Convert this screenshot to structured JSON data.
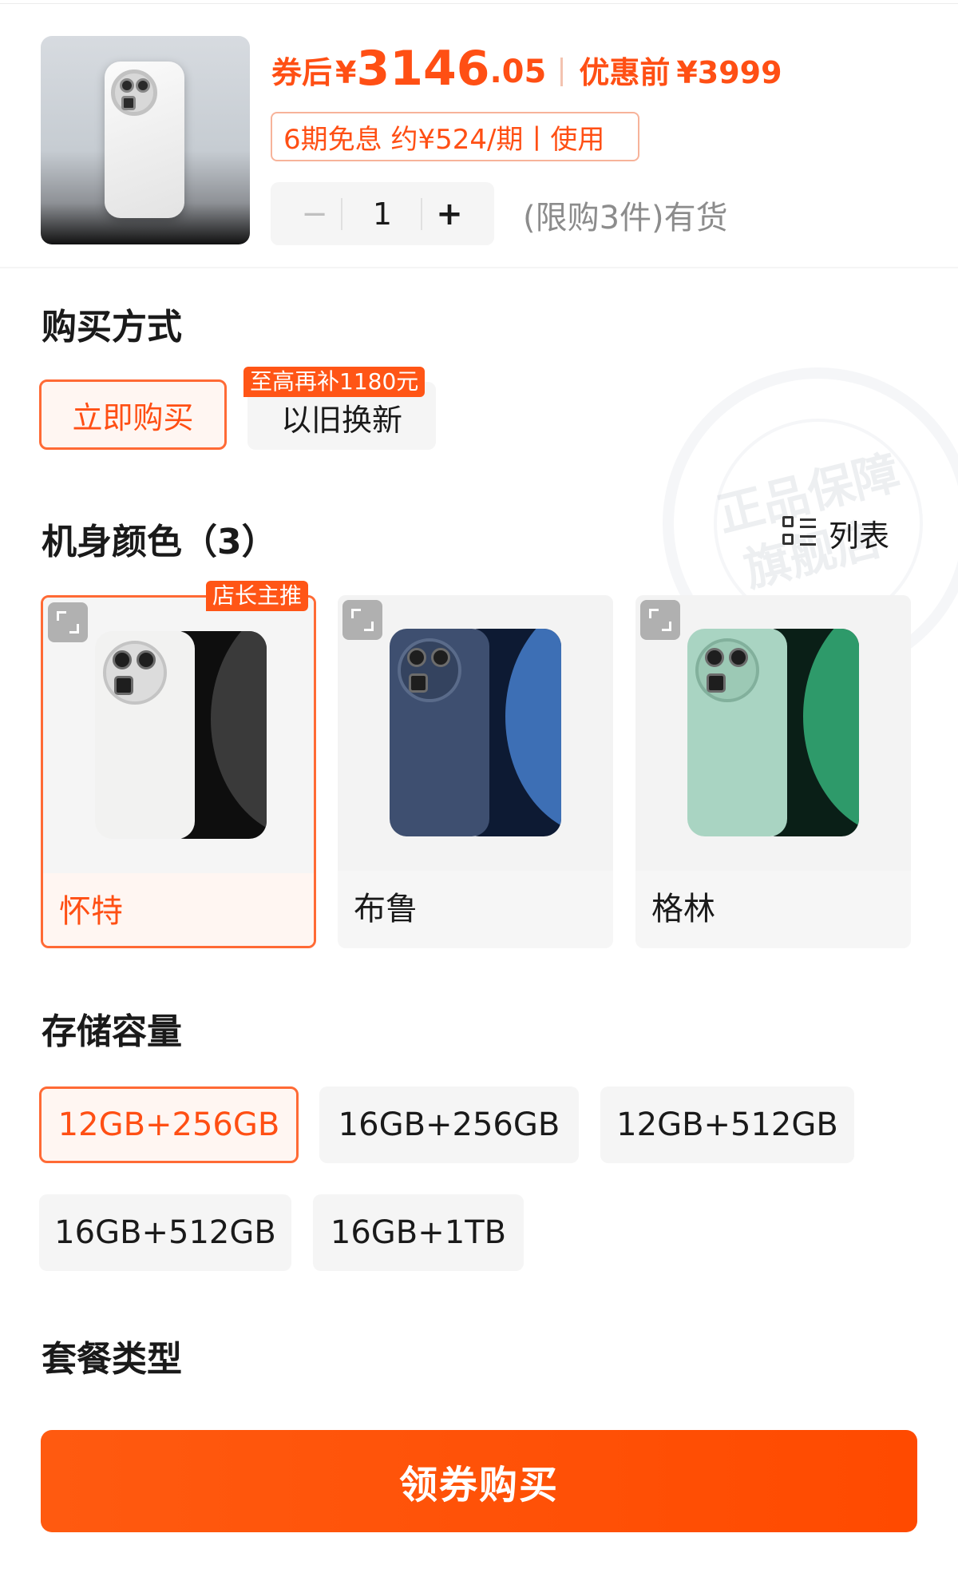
{
  "product": {
    "after_coupon_label": "券后",
    "currency": "¥",
    "price_int": "3146",
    "price_dec": ".05",
    "before_label": "优惠前",
    "price_before": "¥3999",
    "installment": "6期免息 约¥524/期丨使用",
    "quantity": "1",
    "minus_symbol": "−",
    "plus_symbol": "+",
    "stock_text": "(限购3件)有货"
  },
  "purchase_method": {
    "title": "购买方式",
    "options": [
      {
        "label": "立即购买",
        "selected": true
      },
      {
        "label": "以旧换新",
        "selected": false,
        "tag": "至高再补1180元"
      }
    ]
  },
  "color": {
    "title": "机身颜色（3）",
    "list_label": "列表",
    "recommend_tag": "店长主推",
    "options": [
      {
        "name": "怀特",
        "selected": true,
        "back": "#f0f0ef",
        "front": "#101010",
        "arc": "#3a3a3a"
      },
      {
        "name": "布鲁",
        "selected": false,
        "back": "#3e4f70",
        "front": "#0d1a33",
        "arc": "#3d6fb5"
      },
      {
        "name": "格林",
        "selected": false,
        "back": "#a9d4c2",
        "front": "#0a1f17",
        "arc": "#2e9a6a"
      }
    ]
  },
  "storage": {
    "title": "存储容量",
    "options": [
      {
        "label": "12GB+256GB",
        "selected": true
      },
      {
        "label": "16GB+256GB",
        "selected": false
      },
      {
        "label": "12GB+512GB",
        "selected": false
      },
      {
        "label": "16GB+512GB",
        "selected": false
      },
      {
        "label": "16GB+1TB",
        "selected": false
      }
    ]
  },
  "package": {
    "title": "套餐类型"
  },
  "watermark": {
    "line1": "正品保障",
    "line2": "旗舰店"
  },
  "cta": {
    "label": "领券购买"
  },
  "colors": {
    "accent": "#ff4f14",
    "accent_border": "#ff6a35",
    "selected_bg": "#fff6f2",
    "chip_bg": "#f5f5f5"
  },
  "icons": [
    "minus-icon",
    "plus-icon",
    "list-grid-icon",
    "expand-icon"
  ]
}
